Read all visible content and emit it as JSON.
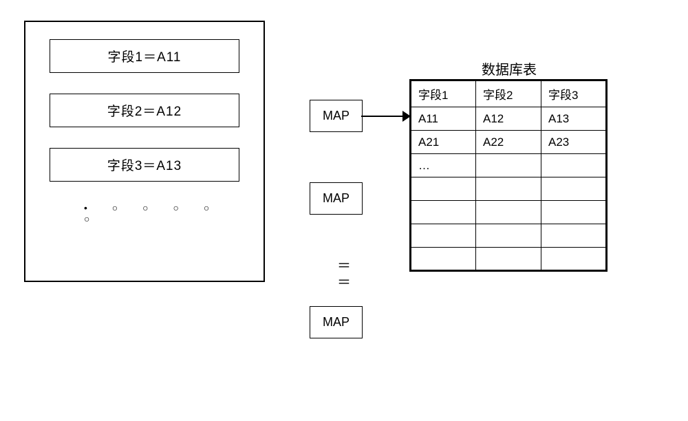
{
  "left_panel": {
    "fields": [
      "字段1＝A11",
      "字段2＝A12",
      "字段3＝A13"
    ],
    "dots": "• ○ ○ ○ ○ ○"
  },
  "map_boxes": {
    "map1": "MAP",
    "map2": "MAP",
    "map3": "MAP"
  },
  "equals": {
    "line1": "＝",
    "line2": "＝"
  },
  "table": {
    "title": "数据库表",
    "headers": [
      "字段1",
      "字段2",
      "字段3"
    ],
    "rows": [
      [
        "A11",
        "A12",
        "A13"
      ],
      [
        "A21",
        "A22",
        "A23"
      ],
      [
        "…",
        "",
        ""
      ],
      [
        "",
        "",
        ""
      ],
      [
        "",
        "",
        ""
      ],
      [
        "",
        "",
        ""
      ],
      [
        "",
        "",
        ""
      ]
    ]
  }
}
